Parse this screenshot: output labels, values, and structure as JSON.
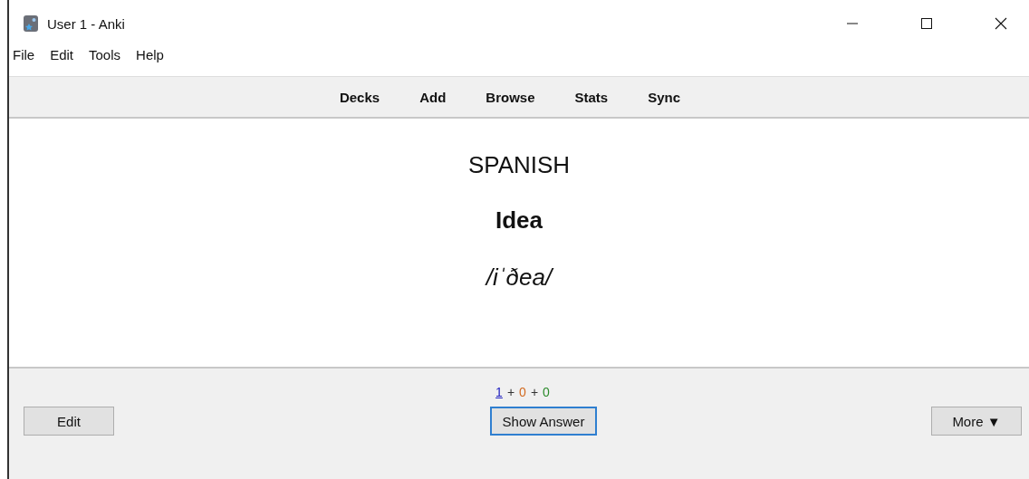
{
  "window": {
    "title": "User 1 - Anki"
  },
  "menu": [
    "File",
    "Edit",
    "Tools",
    "Help"
  ],
  "toolbar": [
    "Decks",
    "Add",
    "Browse",
    "Stats",
    "Sync"
  ],
  "card": {
    "deck": "SPANISH",
    "word": "Idea",
    "pronunciation": "/iˈðea/"
  },
  "counts": [
    {
      "value": "1",
      "color": "#2020c0",
      "underlined": true
    },
    {
      "value": "0",
      "color": "#d2691e",
      "underlined": false
    },
    {
      "value": "0",
      "color": "#2a8a2a",
      "underlined": false
    }
  ],
  "count_separator": "+",
  "buttons": {
    "left": "Edit",
    "center": "Show Answer",
    "right": "More ▼"
  }
}
